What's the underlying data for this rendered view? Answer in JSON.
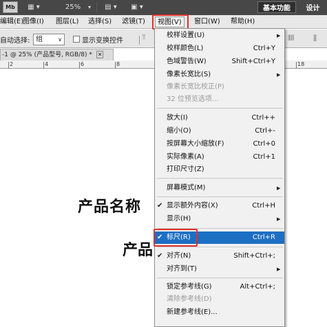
{
  "toolbar": {
    "mb_label": "Mb",
    "zoom": "25%",
    "basic_label": "基本功能",
    "design_label": "设计"
  },
  "menubar": {
    "items": [
      "编辑(E)",
      "图像(I)",
      "图层(L)",
      "选择(S)",
      "滤镜(T)",
      "视图(V)",
      "窗口(W)",
      "帮助(H)"
    ]
  },
  "options": {
    "auto_select_label": "自动选择:",
    "auto_select_value": "组",
    "show_transform_label": "显示变换控件"
  },
  "document": {
    "tab_title": "-1 @ 25% (产品型号, RGB/8) *",
    "ruler_numbers": [
      "2",
      "4",
      "6",
      "8",
      "18"
    ],
    "canvas_title": "产品名称",
    "canvas_subtitle": "产品"
  },
  "view_menu": {
    "items": [
      {
        "label": "校样设置(U)",
        "shortcut": ""
      },
      {
        "label": "校样颜色(L)",
        "shortcut": "Ctrl+Y"
      },
      {
        "label": "色域警告(W)",
        "shortcut": "Shift+Ctrl+Y"
      },
      {
        "label": "像素长宽比(S)",
        "shortcut": ""
      },
      {
        "label": "像素长宽比校正(P)",
        "shortcut": ""
      },
      {
        "label": "32 位预览选项...",
        "shortcut": ""
      },
      {
        "label": "放大(I)",
        "shortcut": "Ctrl++"
      },
      {
        "label": "缩小(O)",
        "shortcut": "Ctrl+-"
      },
      {
        "label": "按屏幕大小缩放(F)",
        "shortcut": "Ctrl+0"
      },
      {
        "label": "实际像素(A)",
        "shortcut": "Ctrl+1"
      },
      {
        "label": "打印尺寸(Z)",
        "shortcut": ""
      },
      {
        "label": "屏幕模式(M)",
        "shortcut": ""
      },
      {
        "label": "显示额外内容(X)",
        "shortcut": "Ctrl+H"
      },
      {
        "label": "显示(H)",
        "shortcut": ""
      },
      {
        "label": "标尺(R)",
        "shortcut": "Ctrl+R"
      },
      {
        "label": "对齐(N)",
        "shortcut": "Shift+Ctrl+;"
      },
      {
        "label": "对齐到(T)",
        "shortcut": ""
      },
      {
        "label": "锁定参考线(G)",
        "shortcut": "Alt+Ctrl+;"
      },
      {
        "label": "清除参考线(D)",
        "shortcut": ""
      },
      {
        "label": "新建参考线(E)...",
        "shortcut": ""
      }
    ]
  },
  "colors": {
    "highlight_border": "#e0312b",
    "selected_row": "#1d6fc3",
    "titlebar": "#474747"
  }
}
